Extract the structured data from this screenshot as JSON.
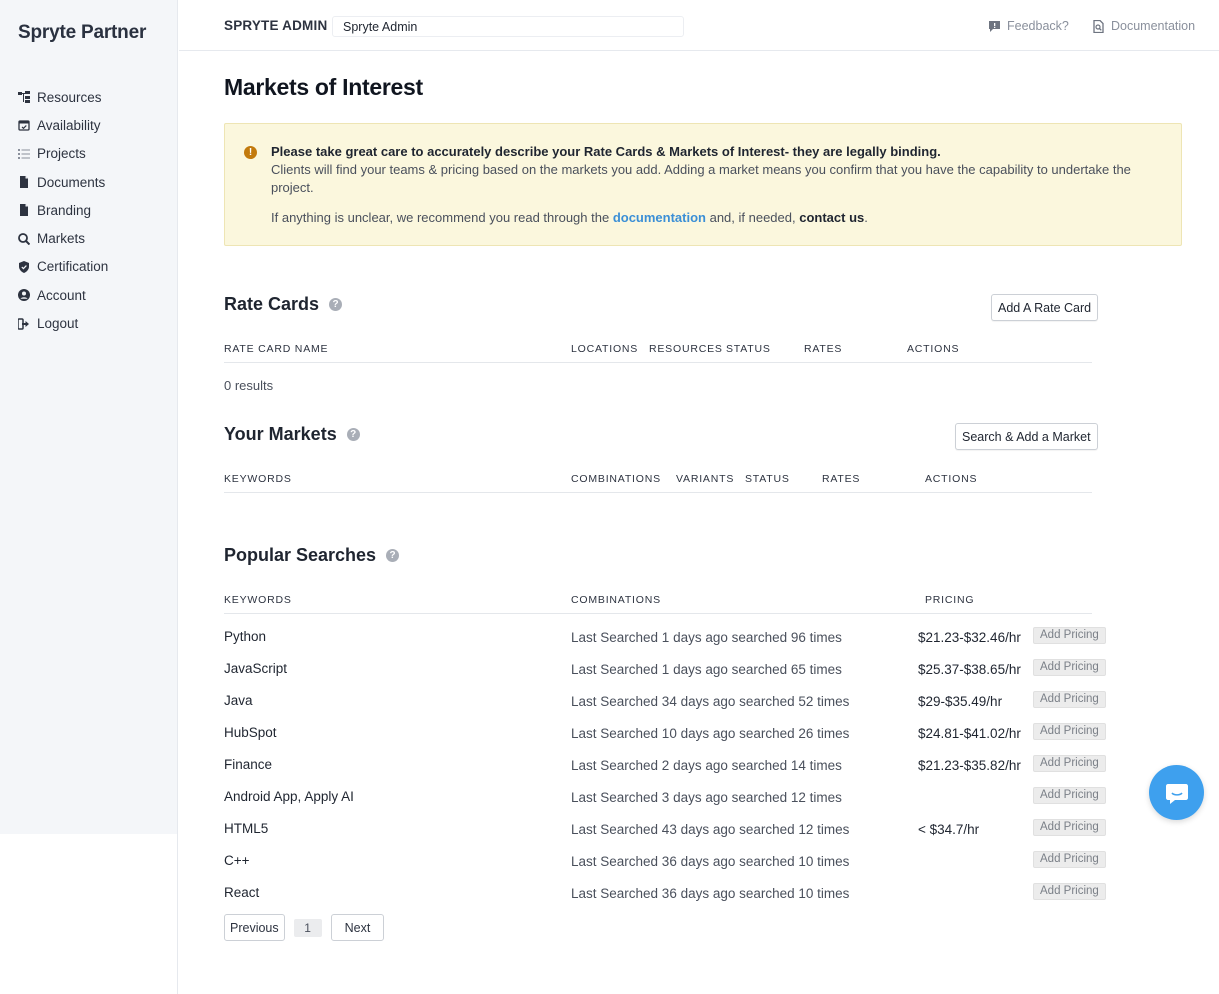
{
  "sidebar": {
    "brand": "Spryte Partner",
    "items": [
      {
        "label": "Resources",
        "icon": "sitemap-icon"
      },
      {
        "label": "Availability",
        "icon": "calendar-icon"
      },
      {
        "label": "Projects",
        "icon": "list-icon"
      },
      {
        "label": "Documents",
        "icon": "file-icon"
      },
      {
        "label": "Branding",
        "icon": "file-icon"
      },
      {
        "label": "Markets",
        "icon": "search-dollar-icon"
      },
      {
        "label": "Certification",
        "icon": "shield-icon"
      },
      {
        "label": "Account",
        "icon": "user-circle-icon"
      },
      {
        "label": "Logout",
        "icon": "sign-out-icon"
      }
    ]
  },
  "topbar": {
    "org_label": "SPRYTE ADMIN",
    "org_value": "Spryte Admin",
    "feedback_label": "Feedback?",
    "docs_label": "Documentation"
  },
  "page": {
    "title": "Markets of Interest"
  },
  "alert": {
    "title": "Please take great care to accurately describe your Rate Cards & Markets of Interest- they are legally binding.",
    "body": "Clients will find your teams & pricing based on the markets you add. Adding a market means you confirm that you have the capability to undertake the project.",
    "foot_prefix": "If anything is unclear, we recommend you read through the ",
    "doc_link": "documentation",
    "foot_middle": " and, if needed, ",
    "contact_link": "contact us",
    "foot_suffix": "."
  },
  "rate_cards": {
    "title": "Rate Cards",
    "add_button": "Add A Rate Card",
    "columns": [
      "RATE CARD NAME",
      "LOCATIONS",
      "RESOURCES",
      "STATUS",
      "RATES",
      "ACTIONS"
    ],
    "results": "0 results"
  },
  "markets": {
    "title": "Your Markets",
    "add_button": "Search & Add a Market",
    "columns": [
      "KEYWORDS",
      "COMBINATIONS",
      "VARIANTS",
      "STATUS",
      "RATES",
      "ACTIONS"
    ]
  },
  "popular": {
    "title": "Popular Searches",
    "columns": [
      "KEYWORDS",
      "COMBINATIONS",
      "PRICING"
    ],
    "pricing_button": "Add Pricing",
    "rows": [
      {
        "keyword": "Python",
        "combinations": "Last Searched 1 days ago searched 96 times",
        "pricing": "$21.23-$32.46/hr"
      },
      {
        "keyword": "JavaScript",
        "combinations": "Last Searched 1 days ago searched 65 times",
        "pricing": "$25.37-$38.65/hr"
      },
      {
        "keyword": "Java",
        "combinations": "Last Searched 34 days ago searched 52 times",
        "pricing": "$29-$35.49/hr"
      },
      {
        "keyword": "HubSpot",
        "combinations": "Last Searched 10 days ago searched 26 times",
        "pricing": "$24.81-$41.02/hr"
      },
      {
        "keyword": "Finance",
        "combinations": "Last Searched 2 days ago searched 14 times",
        "pricing": "$21.23-$35.82/hr"
      },
      {
        "keyword": "Android App, Apply AI",
        "combinations": "Last Searched 3 days ago searched 12 times",
        "pricing": ""
      },
      {
        "keyword": "HTML5",
        "combinations": "Last Searched 43 days ago searched 12 times",
        "pricing": "< $34.7/hr"
      },
      {
        "keyword": "C++",
        "combinations": "Last Searched 36 days ago searched 10 times",
        "pricing": ""
      },
      {
        "keyword": "React",
        "combinations": "Last Searched 36 days ago searched 10 times",
        "pricing": ""
      }
    ]
  },
  "pagination": {
    "prev": "Previous",
    "page": "1",
    "next": "Next"
  },
  "colors": {
    "accent": "#3b8fd6",
    "alert_bg": "#fbf7dd",
    "chat": "#3ea0ee"
  }
}
